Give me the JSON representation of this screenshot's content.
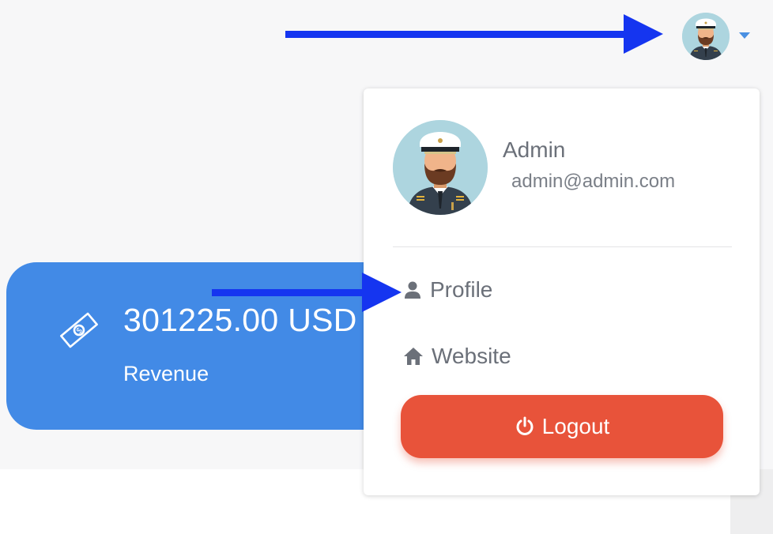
{
  "header": {
    "avatar_icon": "captain-avatar",
    "dropdown_caret_icon": "caret-down-icon",
    "accent_color": "#4a90e2"
  },
  "revenue_card": {
    "icon": "money-icon",
    "value": "301225.00 USD",
    "label": "Revenue",
    "color": "#428ae6"
  },
  "user_menu": {
    "name": "Admin",
    "email": "admin@admin.com",
    "items": [
      {
        "label": "Profile",
        "icon": "user-icon"
      },
      {
        "label": "Website",
        "icon": "home-icon"
      }
    ],
    "logout": {
      "label": "Logout",
      "icon": "power-icon",
      "color": "#e8533a"
    }
  },
  "annotations": {
    "arrow_color": "#1535f0"
  }
}
